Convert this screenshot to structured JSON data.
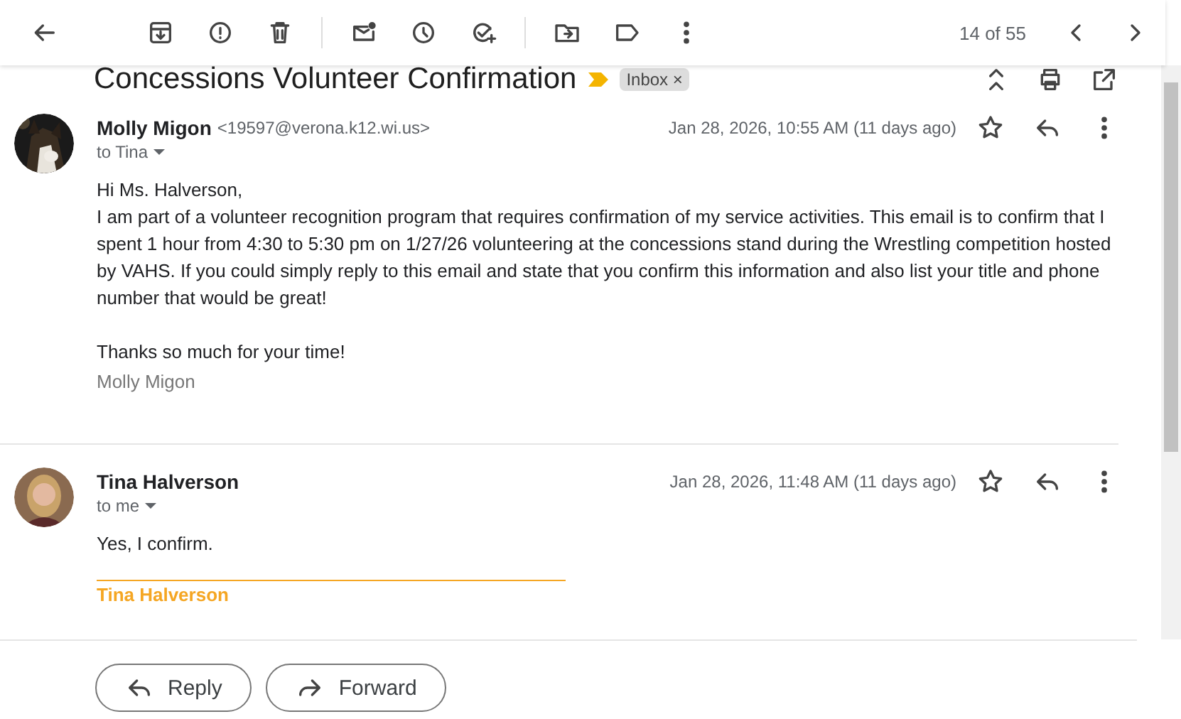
{
  "toolbar": {
    "counter": "14 of 55"
  },
  "subject": {
    "title": "Concessions Volunteer Confirmation",
    "important": true,
    "labels": [
      {
        "text": "Inbox",
        "close": "×"
      }
    ]
  },
  "messages": [
    {
      "sender": "Molly Migon",
      "email": "<19597@verona.k12.wi.us>",
      "to": "to Tina",
      "date": "Jan 28, 2026, 10:55 AM (11 days ago)",
      "starred": false,
      "avatar": {
        "kind": "picture"
      },
      "paragraphs": [
        [
          "Hi Ms. Halverson,",
          "I am part of a volunteer recognition program that requires confirmation of my service activities. This email is to confirm that I spent 1 hour from 4:30 to 5:30 pm on 1/27/26 volunteering at the concessions stand during the Wrestling competition hosted by VAHS. If you could simply reply to this email and state that you confirm this information and also list your title and phone number that would be great!"
        ],
        [
          "Thanks so much for your time!"
        ]
      ],
      "signature": {
        "text": "Molly Migon",
        "kind": "plain"
      }
    },
    {
      "sender": "Tina Halverson",
      "to": "to me",
      "date": "Jan 28, 2026, 11:48 AM (11 days ago)",
      "starred": false,
      "avatar": {
        "kind": "silhouette"
      },
      "paragraphs": [
        [
          "Yes, I confirm."
        ]
      ],
      "signature": {
        "text": "Tina Halverson",
        "kind": "rule"
      }
    }
  ],
  "actions": [
    {
      "label": "Reply",
      "kind": "reply"
    },
    {
      "label": "Forward",
      "kind": "forward"
    }
  ]
}
